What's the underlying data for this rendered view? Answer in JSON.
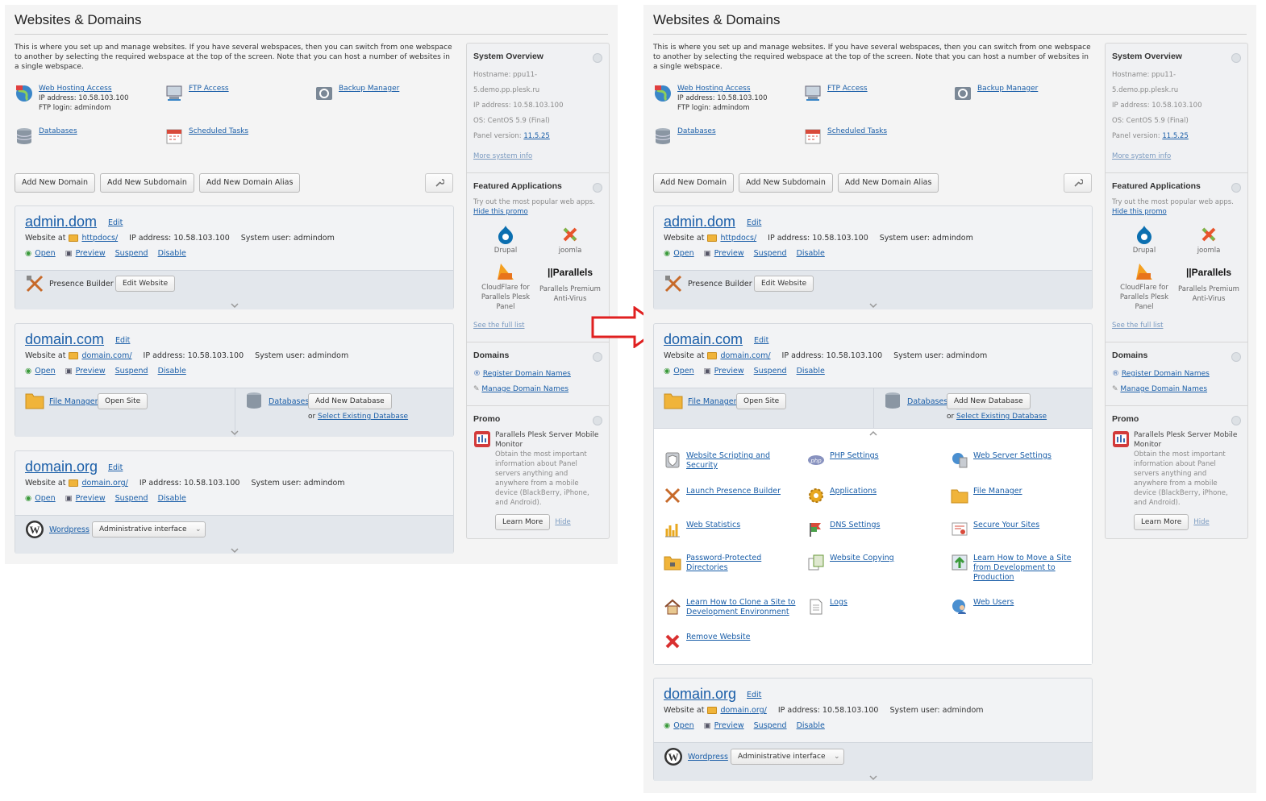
{
  "page_title": "Websites & Domains",
  "intro": "This is where you set up and manage websites. If you have several webspaces, then you can switch from one webspace to another by selecting the required webspace at the top of the screen. Note that you can host a number of websites in a single webspace.",
  "tools": {
    "web_hosting": "Web Hosting Access",
    "ip_line": "IP address: 10.58.103.100",
    "ftp_line": "FTP login: admindom",
    "ftp": "FTP Access",
    "backup": "Backup Manager",
    "databases": "Databases",
    "scheduled": "Scheduled Tasks"
  },
  "buttons": {
    "add_domain": "Add New Domain",
    "add_subdomain": "Add New Subdomain",
    "add_alias": "Add New Domain Alias"
  },
  "common": {
    "edit": "Edit",
    "website_at": "Website at",
    "ip": "IP address: 10.58.103.100",
    "user": "System user: admindom",
    "open": "Open",
    "preview": "Preview",
    "suspend": "Suspend",
    "disable": "Disable"
  },
  "domains": [
    {
      "name": "admin.dom",
      "path": "httpdocs/"
    },
    {
      "name": "domain.com",
      "path": "domain.com/"
    },
    {
      "name": "domain.org",
      "path": "domain.org/"
    }
  ],
  "bands": {
    "presence_builder": "Presence Builder",
    "edit_website": "Edit Website",
    "file_manager": "File Manager",
    "open_site": "Open Site",
    "databases": "Databases",
    "add_db": "Add New Database",
    "or": "or",
    "select_db": "Select Existing Database",
    "wordpress": "Wordpress",
    "admin_iface": "Administrative interface"
  },
  "sidebar": {
    "overview_title": "System Overview",
    "hostname": "Hostname: ppu11-5.demo.pp.plesk.ru",
    "ip": "IP address: 10.58.103.100",
    "os": "OS: CentOS 5.9 (Final)",
    "panel_label": "Panel version:",
    "panel_version": "11.5.25",
    "more_info": "More system info",
    "featured_title": "Featured Applications",
    "featured_text": "Try out the most popular web apps.",
    "hide_promo": "Hide this promo",
    "apps": [
      "Drupal",
      "joomla",
      "CloudFlare for Parallels Plesk Panel",
      "Parallels Premium Anti-Virus"
    ],
    "parallels_logo": "||Parallels",
    "full_list": "See the full list",
    "domains_title": "Domains",
    "register": "Register Domain Names",
    "manage": "Manage Domain Names",
    "promo_title": "Promo",
    "promo_head": "Parallels Plesk Server Mobile Monitor",
    "promo_text": "Obtain the most important information about Panel servers anything and anywhere from a mobile device (BlackBerry, iPhone, and Android).",
    "learn_more": "Learn More",
    "hide": "Hide"
  },
  "expanded_tiles": [
    "Website Scripting and Security",
    "PHP Settings",
    "Web Server Settings",
    "Launch Presence Builder",
    "Applications",
    "File Manager",
    "Web Statistics",
    "DNS Settings",
    "Secure Your Sites",
    "Password-Protected Directories",
    "Website Copying",
    "Learn How to Move a Site from Development to Production",
    "Learn How to Clone a Site to Development Environment",
    "Logs",
    "Web Users",
    "Remove Website"
  ],
  "colors": {
    "link": "#1a5ea8",
    "arrow": "#e02020",
    "panel_bg": "#f4f4f4"
  }
}
